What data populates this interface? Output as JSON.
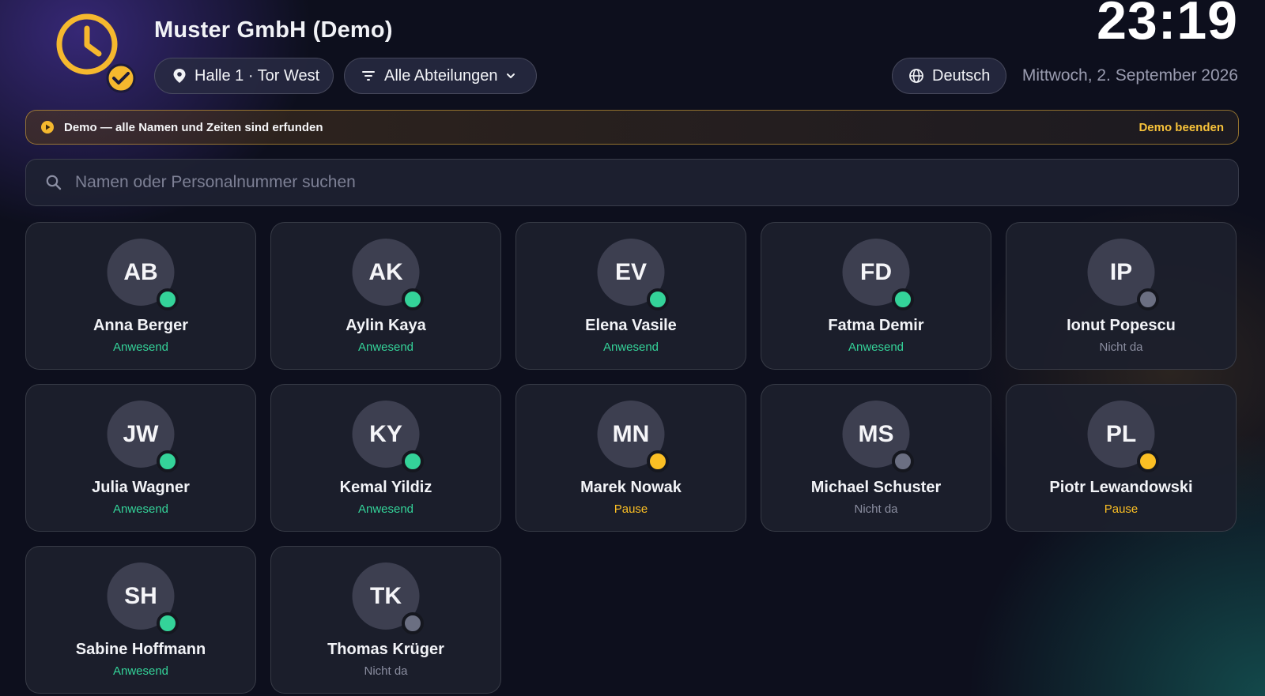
{
  "header": {
    "company": "Muster GmbH (Demo)",
    "location": "Halle 1 · Tor West",
    "department_filter": "Alle Abteilungen",
    "language": "Deutsch",
    "time": "23:19",
    "date": "Mittwoch, 2. September 2026"
  },
  "banner": {
    "text": "Demo — alle Namen und Zeiten sind erfunden",
    "action": "Demo beenden"
  },
  "search": {
    "placeholder": "Namen oder Personalnummer suchen"
  },
  "colors": {
    "accent": "#f5b82e",
    "present": "#34d399",
    "pause": "#fbbf24",
    "absent": "#6b6f82"
  },
  "employees": [
    {
      "initials": "AB",
      "name": "Anna Berger",
      "status": "Anwesend",
      "state": "present"
    },
    {
      "initials": "AK",
      "name": "Aylin Kaya",
      "status": "Anwesend",
      "state": "present"
    },
    {
      "initials": "EV",
      "name": "Elena Vasile",
      "status": "Anwesend",
      "state": "present"
    },
    {
      "initials": "FD",
      "name": "Fatma Demir",
      "status": "Anwesend",
      "state": "present"
    },
    {
      "initials": "IP",
      "name": "Ionut Popescu",
      "status": "Nicht da",
      "state": "absent"
    },
    {
      "initials": "JW",
      "name": "Julia Wagner",
      "status": "Anwesend",
      "state": "present"
    },
    {
      "initials": "KY",
      "name": "Kemal Yildiz",
      "status": "Anwesend",
      "state": "present"
    },
    {
      "initials": "MN",
      "name": "Marek Nowak",
      "status": "Pause",
      "state": "pause"
    },
    {
      "initials": "MS",
      "name": "Michael Schuster",
      "status": "Nicht da",
      "state": "absent"
    },
    {
      "initials": "PL",
      "name": "Piotr Lewandowski",
      "status": "Pause",
      "state": "pause"
    },
    {
      "initials": "SH",
      "name": "Sabine Hoffmann",
      "status": "Anwesend",
      "state": "present"
    },
    {
      "initials": "TK",
      "name": "Thomas Krüger",
      "status": "Nicht da",
      "state": "absent"
    }
  ]
}
